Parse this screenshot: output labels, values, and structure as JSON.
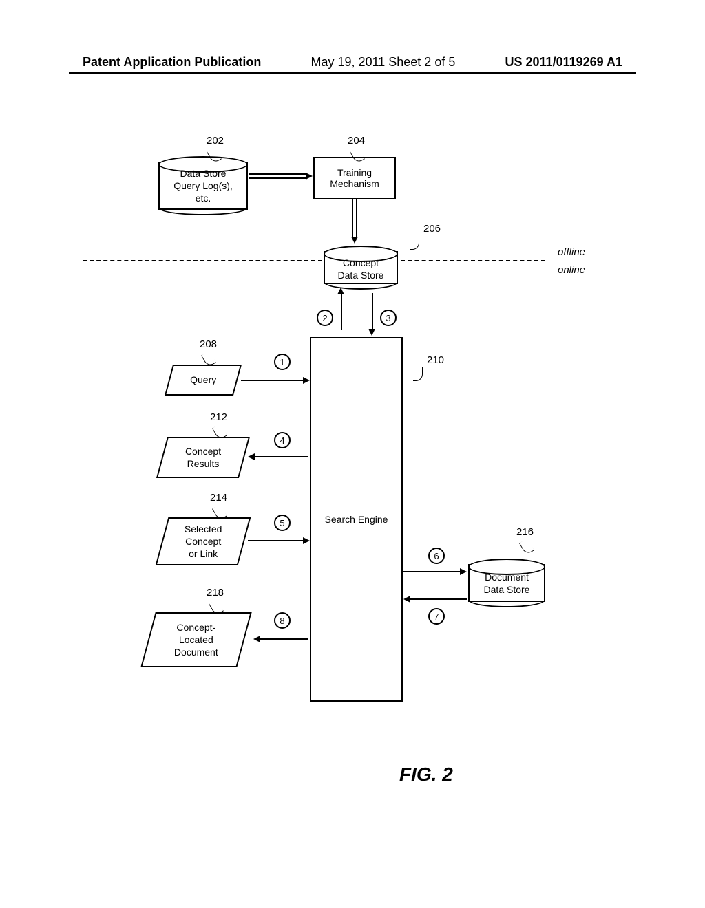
{
  "header": {
    "left": "Patent Application Publication",
    "center": "May 19, 2011  Sheet 2 of 5",
    "right": "US 2011/0119269 A1"
  },
  "refs": {
    "r202": "202",
    "r204": "204",
    "r206": "206",
    "r208": "208",
    "r210": "210",
    "r212": "212",
    "r214": "214",
    "r216": "216",
    "r218": "218"
  },
  "labels": {
    "dataStore": "Data Store\nQuery Log(s),\netc.",
    "trainingMechanism": "Training\nMechanism",
    "conceptDataStore": "Concept\nData Store",
    "query": "Query",
    "conceptResults": "Concept\nResults",
    "selectedConcept": "Selected\nConcept\nor Link",
    "conceptLocated": "Concept-\nLocated\nDocument",
    "searchEngine": "Search Engine",
    "documentDataStore": "Document\nData Store",
    "offline": "offline",
    "online": "online"
  },
  "steps": {
    "s1": "1",
    "s2": "2",
    "s3": "3",
    "s4": "4",
    "s5": "5",
    "s6": "6",
    "s7": "7",
    "s8": "8"
  },
  "caption": "FIG. 2"
}
